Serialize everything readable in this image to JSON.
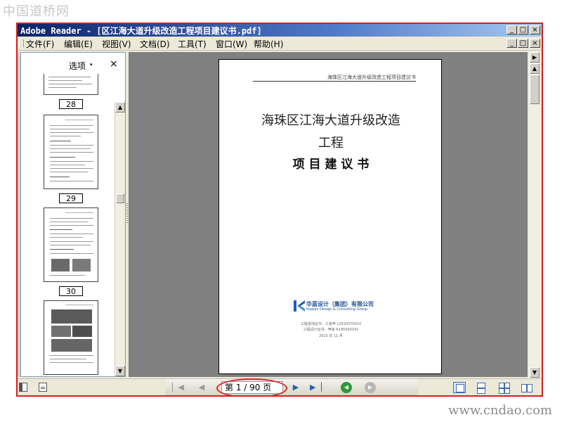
{
  "watermark_top": "中国道桥网",
  "watermark_bottom": "www.cndao.com",
  "window": {
    "title": "Adobe Reader - [区江海大道升级改造工程项目建议书.pdf]",
    "minimize_glyph": "_",
    "maximize_glyph": "□",
    "close_glyph": "×"
  },
  "menu": [
    {
      "label": "文件(F)"
    },
    {
      "label": "编辑(E)"
    },
    {
      "label": "视图(V)"
    },
    {
      "label": "文档(D)"
    },
    {
      "label": "工具(T)"
    },
    {
      "label": "窗口(W)"
    },
    {
      "label": "帮助(H)"
    }
  ],
  "sidebar": {
    "options_label": "选项",
    "options_arrow": "▾",
    "close_glyph": "×",
    "thumbnails": [
      {
        "page_label": "28"
      },
      {
        "page_label": "29"
      },
      {
        "page_label": "30"
      }
    ]
  },
  "document": {
    "header": "海珠区江海大道升级改造工程项目建议书",
    "title_line1": "海珠区江海大道升级改造",
    "title_line2": "工程",
    "title_line3": "项 目 建 议 书",
    "logo_name_cn": "华蓝设计（集团）有限公司",
    "logo_name_en": "Hualan Design & Consulting Group",
    "cert_line1": "工程咨询证书：工咨甲 12520070010",
    "cert_line2": "工程设计证书：甲级 A145000242",
    "date": "2015 年 11 月"
  },
  "navigation": {
    "page_display": "第 1 / 90 页",
    "first_glyph": "▏◀",
    "prev_glyph": "◀",
    "next_glyph": "▶",
    "last_glyph": "▶▕",
    "back_glyph": "◀",
    "forward_glyph": "▶"
  },
  "colors": {
    "title_bar": "#0a246a",
    "highlight": "#e02020",
    "document_background": "#808080",
    "nav_green": "#2e9a3a"
  }
}
